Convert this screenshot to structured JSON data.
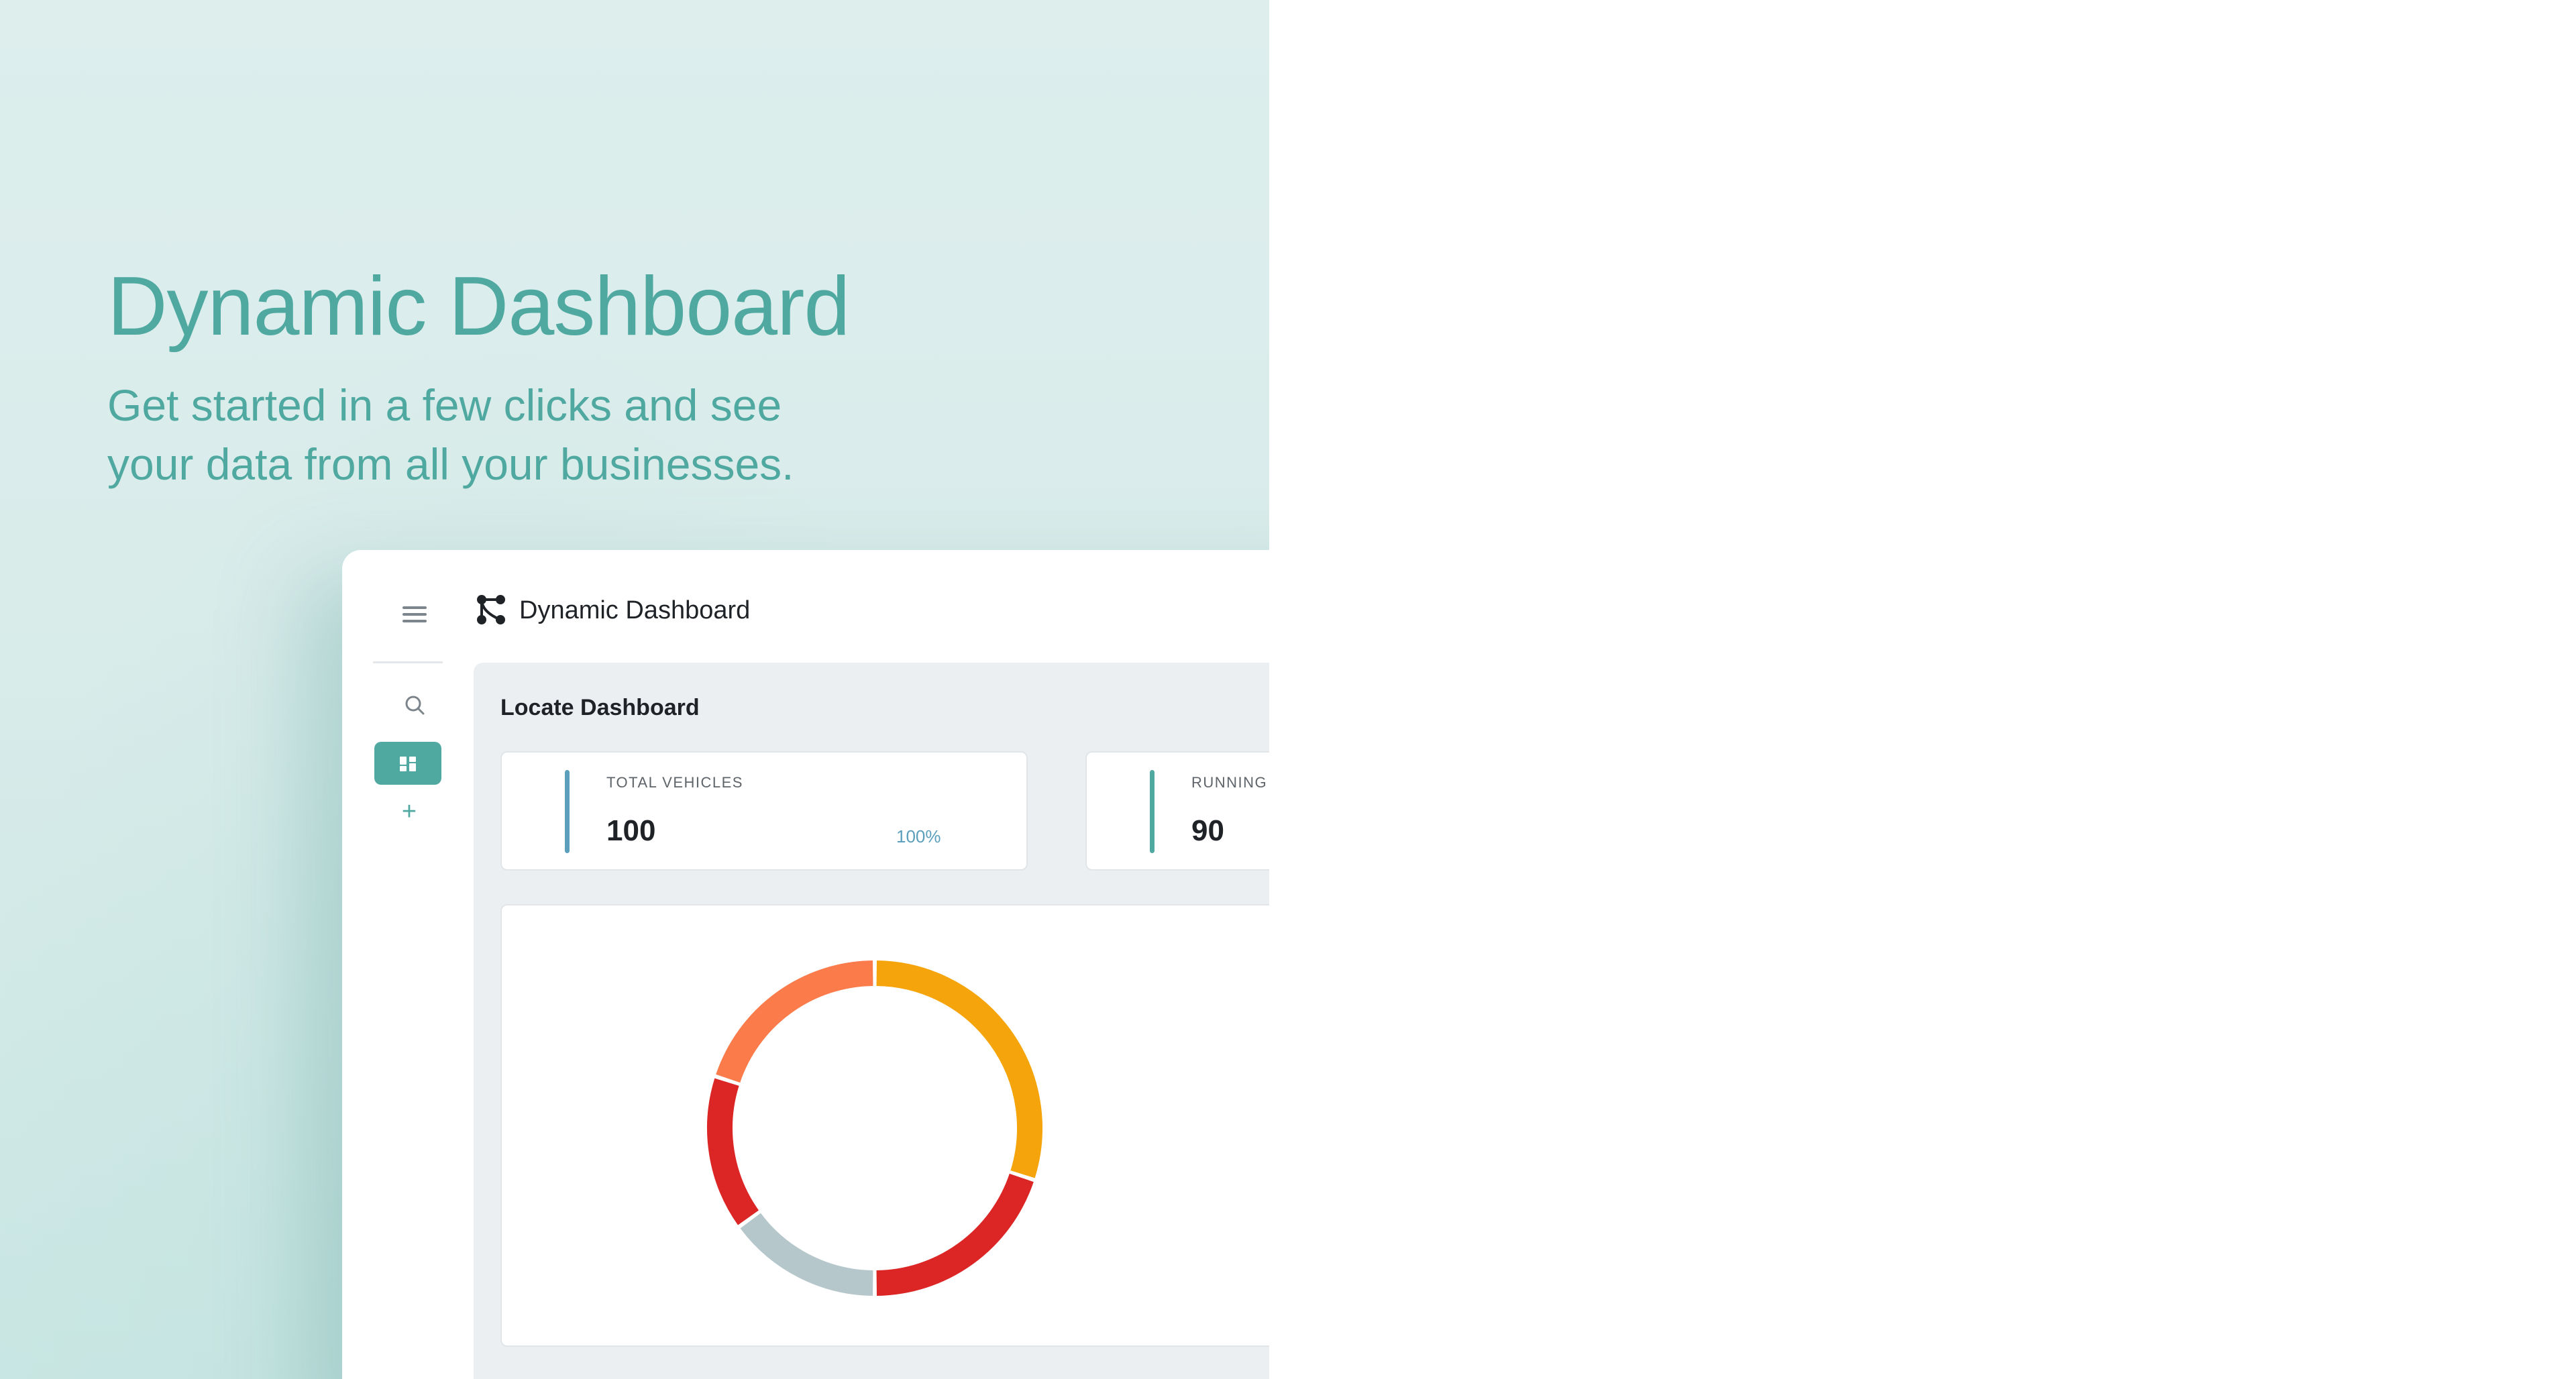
{
  "hero": {
    "title": "Dynamic Dashboard",
    "subtitle_line1": "Get started in a few clicks and see",
    "subtitle_line2": "your data from all your businesses."
  },
  "app": {
    "title": "Dynamic Dashboard",
    "logo_icon": "workflow-nodes-icon",
    "sidebar": {
      "items": [
        {
          "icon": "menu-icon",
          "active": false
        },
        {
          "icon": "search-icon",
          "active": false
        },
        {
          "icon": "dashboard-icon",
          "active": true
        },
        {
          "icon": "plus-icon",
          "active": false
        }
      ]
    },
    "section_title": "Locate Dashboard",
    "stat_cards": [
      {
        "label": "TOTAL VEHICLES",
        "value": "100",
        "percent": "100%",
        "accent": "#5b9fbd"
      },
      {
        "label": "RUNNING V",
        "value": "90",
        "accent": "#4fa9a1"
      }
    ],
    "chart_data": {
      "type": "pie",
      "donut": true,
      "title": "",
      "legend": "none",
      "segments": [
        {
          "value": 30,
          "color": "#f5a50b"
        },
        {
          "value": 20,
          "color": "#dc2626"
        },
        {
          "value": 15,
          "color": "#b6c7cc"
        },
        {
          "value": 15,
          "color": "#dc2626"
        },
        {
          "value": 20,
          "color": "#fb7b4b"
        }
      ]
    }
  },
  "colors": {
    "accent": "#4fa9a1",
    "hero_bg": "#ddeeed"
  }
}
